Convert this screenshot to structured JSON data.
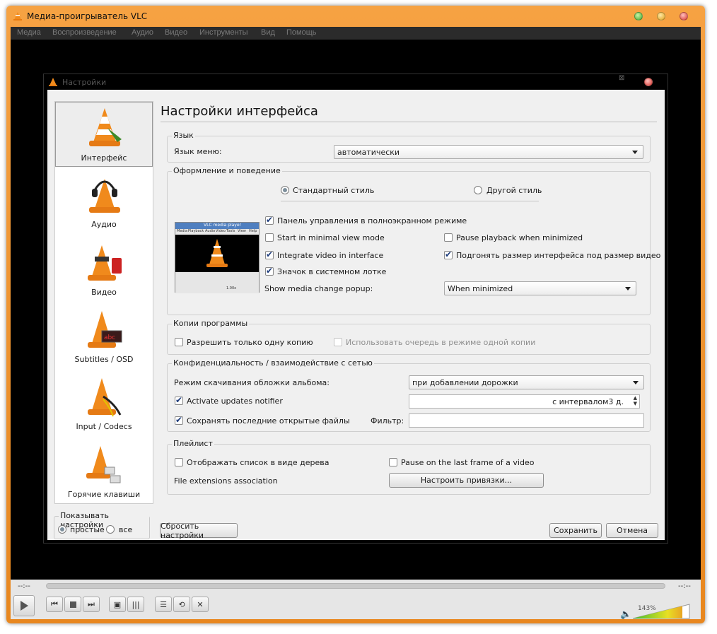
{
  "window": {
    "title": "Медиа-проигрыватель VLC"
  },
  "menu": [
    "Медиа",
    "Воспроизведение",
    "Аудио",
    "Видео",
    "Инструменты",
    "Вид",
    "Помощь"
  ],
  "dialog": {
    "title": "Настройки",
    "categories": [
      "Интерфейс",
      "Аудио",
      "Видео",
      "Subtitles / OSD",
      "Input / Codecs",
      "Горячие клавиши"
    ],
    "show_settings": {
      "legend": "Показывать настройки",
      "simple": "простые",
      "all": "все"
    },
    "heading": "Настройки интерфейса",
    "language": {
      "legend": "Язык",
      "label": "Язык меню:",
      "value": "автоматически"
    },
    "look": {
      "legend": "Оформление и поведение",
      "native_style": "Стандартный стиль",
      "custom_style": "Другой стиль",
      "fullscreen_controller": "Панель управления в полноэкранном режиме",
      "minimal_view": "Start in minimal view mode",
      "pause_minimized": "Pause playback when minimized",
      "integrate_video": "Integrate video in interface",
      "resize_to_video": "Подгонять размер интерфейса под размер видео",
      "systray": "Значок в системном лотке",
      "popup_label": "Show media change popup:",
      "popup_value": "When minimized",
      "preview": {
        "title": "VLC media player",
        "menu": [
          "Media",
          "Playback",
          "Audio",
          "Video",
          "Tools",
          "View",
          "Help"
        ],
        "volume": "1.00x"
      }
    },
    "instances": {
      "legend": "Копии программы",
      "one_instance": "Разрешить только одну копию",
      "enqueue": "Использовать очередь в режиме одной копии"
    },
    "privacy": {
      "legend": "Конфиденциальность / взаимодействие с сетью",
      "art_label": "Режим скачивания обложки альбома:",
      "art_value": "при добавлении дорожки",
      "updates": "Activate updates notifier",
      "interval": "с интервалом3 д.",
      "recent": "Сохранять последние открытые файлы",
      "filter_label": "Фильтр:",
      "filter_value": ""
    },
    "playlist": {
      "legend": "Плейлист",
      "tree": "Отображать список в виде дерева",
      "pause_last": "Pause on the last frame of a video",
      "assoc_label": "File extensions association",
      "assoc_button": "Настроить привязки..."
    },
    "buttons": {
      "reset": "Сбросить настройки",
      "save": "Сохранить",
      "cancel": "Отмена"
    }
  },
  "player": {
    "time_left": "--:--",
    "time_right": "--:--",
    "volume": "143%"
  },
  "colors": {
    "frame": "#f29a38",
    "video": "#000000",
    "dialog_bg": "#f0f0f0",
    "volume_green": "#3fbf2a"
  }
}
